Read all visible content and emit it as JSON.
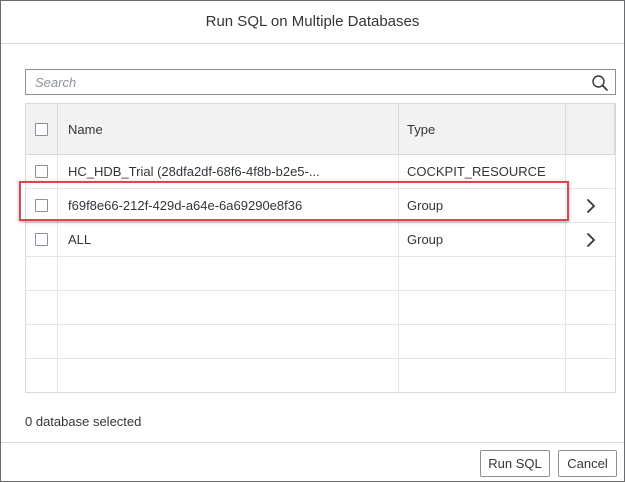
{
  "dialog": {
    "title": "Run SQL on Multiple Databases"
  },
  "search": {
    "placeholder": "Search",
    "value": ""
  },
  "table": {
    "columns": {
      "name": "Name",
      "type": "Type"
    },
    "rows": [
      {
        "name": "HC_HDB_Trial (28dfa2df-68f6-4f8b-b2e5-...",
        "type": "COCKPIT_RESOURCE",
        "has_nav": false,
        "checked": false
      },
      {
        "name": "f69f8e66-212f-429d-a64e-6a69290e8f36",
        "type": "Group",
        "has_nav": true,
        "checked": false,
        "highlighted": true
      },
      {
        "name": "ALL",
        "type": "Group",
        "has_nav": true,
        "checked": false
      },
      {
        "name": "",
        "type": "",
        "has_nav": false
      },
      {
        "name": "",
        "type": "",
        "has_nav": false
      },
      {
        "name": "",
        "type": "",
        "has_nav": false
      },
      {
        "name": "",
        "type": "",
        "has_nav": false
      }
    ]
  },
  "status": {
    "selected_text": "0 database selected"
  },
  "footer": {
    "run_label": "Run SQL",
    "cancel_label": "Cancel"
  },
  "colors": {
    "highlight_border": "#e0454b",
    "header_bg": "#f2f2f2",
    "text": "#32363a"
  },
  "icons": {
    "search": "search-icon",
    "row_nav": "chevron-right-icon"
  }
}
